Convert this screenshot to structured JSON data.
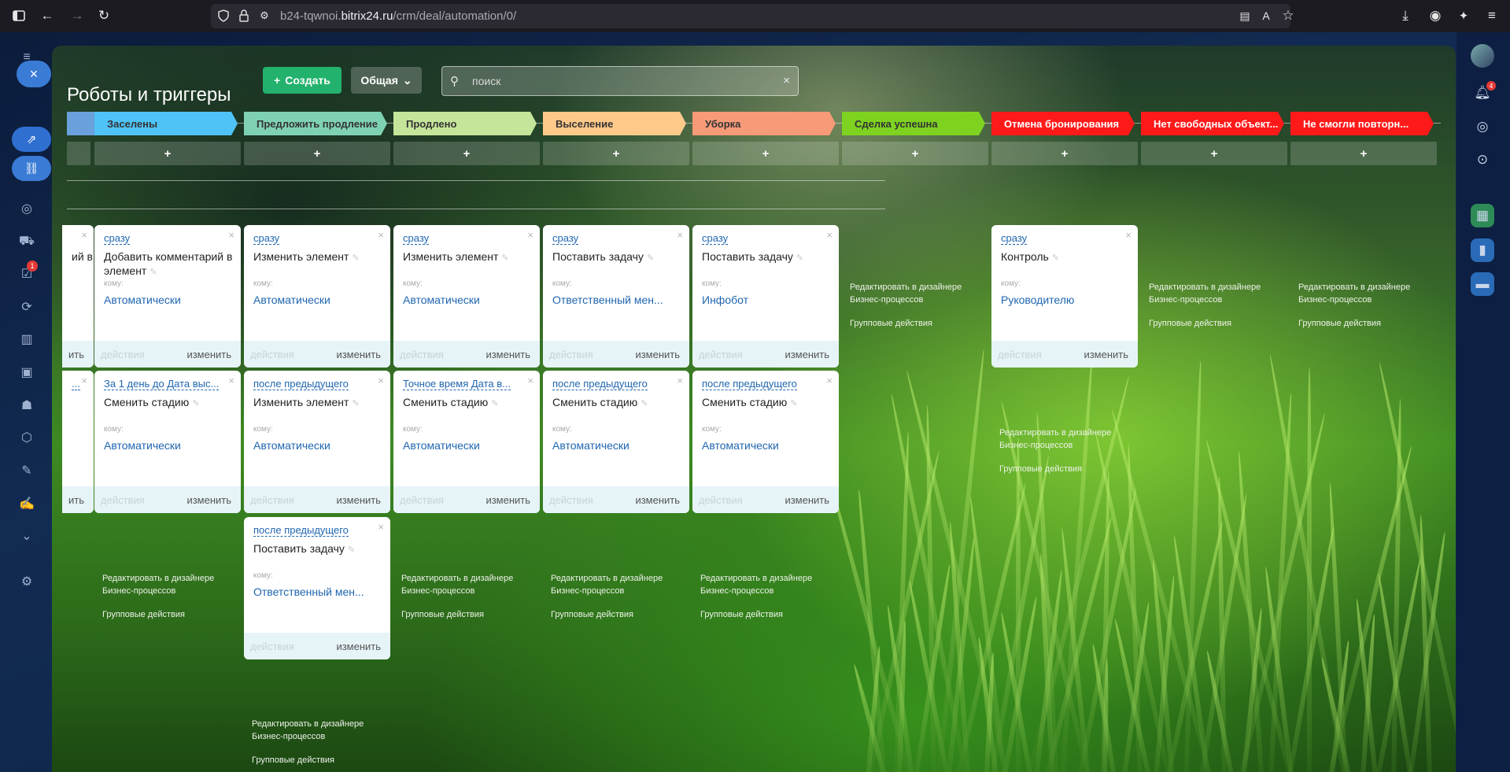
{
  "browser": {
    "url_prefix": "b24-tqwnoi.",
    "url_host": "bitrix24.ru",
    "url_path": "/crm/deal/automation/0/"
  },
  "icons": {
    "sidebar_toggle": "sidebar-toggle-icon",
    "back": "back-arrow-icon",
    "forward": "forward-arrow-icon",
    "reload": "reload-icon",
    "shield": "shield-icon",
    "lock": "lock-icon",
    "permissions": "permissions-icon",
    "reader": "reader-view-icon",
    "translate": "translate-icon",
    "bookmark": "star-icon",
    "download": "download-icon",
    "account": "account-icon",
    "extensions": "extensions-icon",
    "menu": "menu-icon"
  },
  "sidebar": {
    "badge": "1"
  },
  "rightbar": {
    "notifications_badge": "4"
  },
  "header": {
    "title": "Роботы и триггеры",
    "create_label": "Создать",
    "general_label": "Общая",
    "search_placeholder": "поиск"
  },
  "stages": [
    {
      "name": "",
      "color": "#6aa0dc",
      "text_color": "#333"
    },
    {
      "name": "Заселены",
      "color": "#4fc3f7",
      "text_color": "#333"
    },
    {
      "name": "Предложить продление",
      "color": "#7fd1b3",
      "text_color": "#333"
    },
    {
      "name": "Продлено",
      "color": "#c5e59a",
      "text_color": "#333"
    },
    {
      "name": "Выселение",
      "color": "#ffc98a",
      "text_color": "#333"
    },
    {
      "name": "Уборка",
      "color": "#f79a78",
      "text_color": "#333"
    },
    {
      "name": "Сделка успешна",
      "color": "#7ed321",
      "text_color": "#333"
    },
    {
      "name": "Отмена бронирования",
      "color": "#ff1a1a",
      "text_color": "#fff"
    },
    {
      "name": "Нет свободных объект...",
      "color": "#ff1a1a",
      "text_color": "#fff"
    },
    {
      "name": "Не смогли повторн...",
      "color": "#ff1a1a",
      "text_color": "#fff"
    }
  ],
  "add_symbol": "+",
  "labels": {
    "to": "кому:",
    "actions": "действия",
    "change": "изменить",
    "edit_designer": "Редактировать в дизайнере Бизнес-процессов",
    "group_actions": "Групповые действия",
    "close": "×"
  },
  "cards": {
    "row1": [
      {
        "when": "",
        "name": "ий в",
        "who": ""
      },
      {
        "when": "сразу",
        "name": "Добавить комментарий в элемент",
        "who": "Автоматически"
      },
      {
        "when": "сразу",
        "name": "Изменить элемент",
        "who": "Автоматически"
      },
      {
        "when": "сразу",
        "name": "Изменить элемент",
        "who": "Автоматически"
      },
      {
        "when": "сразу",
        "name": "Поставить задачу",
        "who": "Ответственный мен..."
      },
      {
        "when": "сразу",
        "name": "Поставить задачу",
        "who": "Инфобот"
      },
      {
        "when": "сразу",
        "name": "Контроль",
        "who": "Руководителю"
      }
    ],
    "row2": [
      {
        "when": "...",
        "name": "",
        "who": ""
      },
      {
        "when": "За 1 день до Дата выс...",
        "name": "Сменить стадию",
        "who": "Автоматически"
      },
      {
        "when": "после предыдущего",
        "name": "Изменить элемент",
        "who": "Автоматически"
      },
      {
        "when": "Точное время Дата в...",
        "name": "Сменить стадию",
        "who": "Автоматически"
      },
      {
        "when": "после предыдущего",
        "name": "Сменить стадию",
        "who": "Автоматически"
      },
      {
        "when": "после предыдущего",
        "name": "Сменить стадию",
        "who": "Автоматически"
      }
    ],
    "row3": [
      {
        "when": "после предыдущего",
        "name": "Поставить задачу",
        "who": "Ответственный мен..."
      }
    ]
  }
}
